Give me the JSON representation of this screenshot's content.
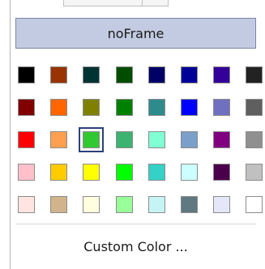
{
  "no_frame_label": "noFrame",
  "custom_color_label": "Custom Color ...",
  "selected_color": "#32c832",
  "swatch_rows": [
    [
      "#000000",
      "#993300",
      "#003333",
      "#004d00",
      "#000066",
      "#000099",
      "#330099",
      "#222222"
    ],
    [
      "#800000",
      "#ff6600",
      "#808000",
      "#008000",
      "#2e8b8b",
      "#0000ff",
      "#7070c0",
      "#5f5f5f"
    ],
    [
      "#ff0000",
      "#ffa050",
      "#32c832",
      "#3cb371",
      "#80ffd4",
      "#7a9fc8",
      "#800080",
      "#909090"
    ],
    [
      "#ffc0cb",
      "#ffcc00",
      "#ffff00",
      "#00ff00",
      "#33d1c6",
      "#ccffff",
      "#4b004b",
      "#c0c0c0"
    ],
    [
      "#ffe4e1",
      "#d2b48c",
      "#ffffe0",
      "#99ff99",
      "#c6f4f4",
      "#607880",
      "#e6e6fa",
      "#ffffff"
    ]
  ]
}
